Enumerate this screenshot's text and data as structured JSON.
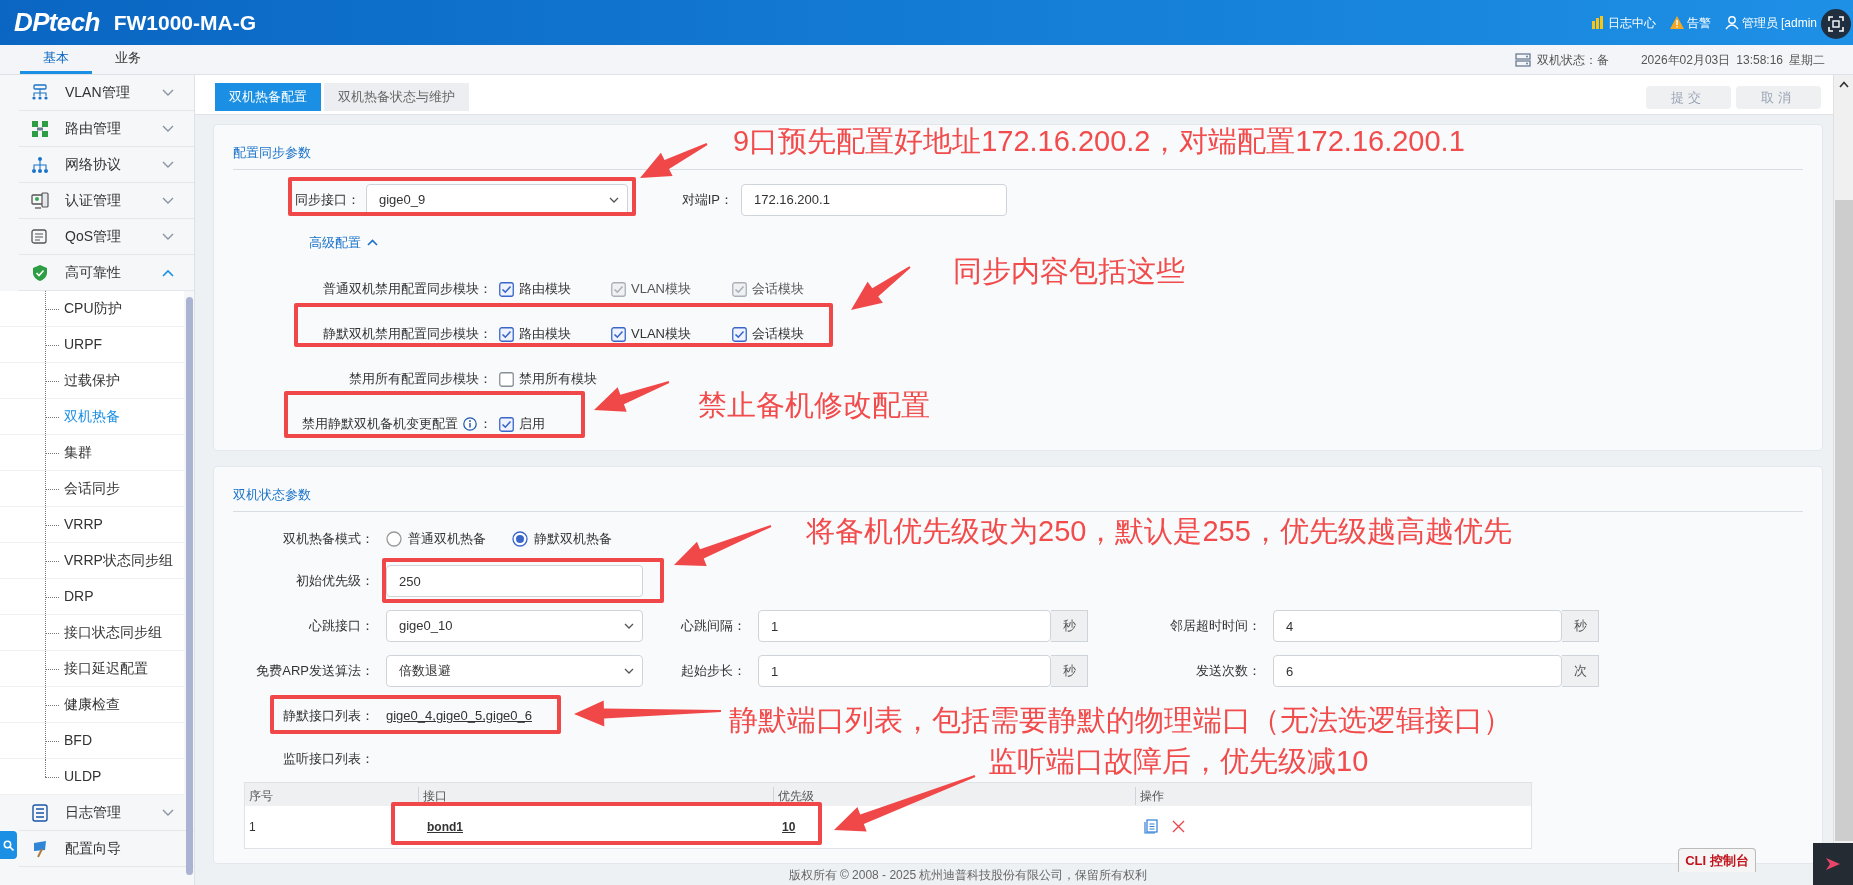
{
  "header": {
    "logo": "DPtech",
    "product": "FW1000-MA-G",
    "links": [
      {
        "label": "日志中心"
      },
      {
        "label": "告警"
      },
      {
        "label": "管理员 [admin"
      }
    ]
  },
  "nav_tabs": [
    {
      "label": "基本",
      "selected": true
    },
    {
      "label": "业务",
      "selected": false
    }
  ],
  "status_bar": {
    "ha_state": "双机状态：备",
    "date": "2026年02月03日",
    "time": "13:58:16",
    "weekday": "星期二"
  },
  "sidebar": {
    "items": [
      {
        "label": "VLAN管理",
        "kind": "group",
        "expanded": false
      },
      {
        "label": "路由管理",
        "kind": "group",
        "expanded": false
      },
      {
        "label": "网络协议",
        "kind": "group",
        "expanded": false
      },
      {
        "label": "认证管理",
        "kind": "group",
        "expanded": false
      },
      {
        "label": "QoS管理",
        "kind": "group",
        "expanded": false
      },
      {
        "label": "高可靠性",
        "kind": "group",
        "expanded": true,
        "children": [
          {
            "label": "CPU防护",
            "selected": false
          },
          {
            "label": "URPF",
            "selected": false
          },
          {
            "label": "过载保护",
            "selected": false
          },
          {
            "label": "双机热备",
            "selected": true
          },
          {
            "label": "集群",
            "selected": false
          },
          {
            "label": "会话同步",
            "selected": false
          },
          {
            "label": "VRRP",
            "selected": false
          },
          {
            "label": "VRRP状态同步组",
            "selected": false
          },
          {
            "label": "DRP",
            "selected": false
          },
          {
            "label": "接口状态同步组",
            "selected": false
          },
          {
            "label": "接口延迟配置",
            "selected": false
          },
          {
            "label": "健康检查",
            "selected": false
          },
          {
            "label": "BFD",
            "selected": false
          },
          {
            "label": "ULDP",
            "selected": false
          }
        ]
      },
      {
        "label": "日志管理",
        "kind": "group",
        "expanded": false
      },
      {
        "label": "配置向导",
        "kind": "link"
      }
    ]
  },
  "page_tabs": [
    {
      "label": "双机热备配置",
      "selected": true
    },
    {
      "label": "双机热备状态与维护",
      "selected": false
    }
  ],
  "actions": [
    {
      "label": "提交",
      "disabled": true
    },
    {
      "label": "取消",
      "disabled": true
    }
  ],
  "sync_section": {
    "title": "配置同步参数",
    "fields": [
      {
        "label": "同步接口：",
        "kind": "select",
        "value": "gige0_9"
      },
      {
        "label": "对端IP：",
        "kind": "input",
        "value": "172.16.200.1"
      }
    ],
    "advanced": {
      "label": "高级配置",
      "expanded": true
    },
    "module_rows": [
      {
        "label": "普通双机禁用配置同步模块",
        "colon": "：",
        "info": false,
        "options": [
          {
            "label": "路由模块",
            "checked": true,
            "disabled": false
          },
          {
            "label": "VLAN模块",
            "checked": true,
            "disabled": true
          },
          {
            "label": "会话模块",
            "checked": true,
            "disabled": true
          }
        ]
      },
      {
        "label": "静默双机禁用配置同步模块",
        "colon": "：",
        "info": false,
        "options": [
          {
            "label": "路由模块",
            "checked": true,
            "disabled": false
          },
          {
            "label": "VLAN模块",
            "checked": true,
            "disabled": false
          },
          {
            "label": "会话模块",
            "checked": true,
            "disabled": false
          }
        ]
      },
      {
        "label": "禁用所有配置同步模块",
        "colon": "：",
        "info": false,
        "options": [
          {
            "label": "禁用所有模块",
            "checked": false,
            "disabled": false
          }
        ]
      },
      {
        "label": "禁用静默双机备机变更配置",
        "colon": "：",
        "info": true,
        "options": [
          {
            "label": "启用",
            "checked": true,
            "disabled": false
          }
        ]
      }
    ]
  },
  "state_section": {
    "title": "双机状态参数",
    "mode": {
      "label": "双机热备模式：",
      "options": [
        {
          "label": "普通双机热备",
          "selected": false
        },
        {
          "label": "静默双机热备",
          "selected": true
        }
      ]
    },
    "initial_priority": {
      "label": "初始优先级：",
      "value": "250"
    },
    "field_rows": [
      [
        {
          "label": "心跳接口：",
          "kind": "select",
          "value": "gige0_10"
        },
        {
          "label": "心跳间隔：",
          "kind": "input",
          "value": "1",
          "unit": "秒"
        },
        {
          "label": "邻居超时时间：",
          "kind": "input",
          "value": "4",
          "unit": "秒"
        }
      ],
      [
        {
          "label": "免费ARP发送算法：",
          "kind": "select",
          "value": "倍数退避"
        },
        {
          "label": "起始步长：",
          "kind": "input",
          "value": "1",
          "unit": "秒"
        },
        {
          "label": "发送次数：",
          "kind": "input",
          "value": "6",
          "unit": "次"
        }
      ]
    ],
    "silent_interfaces": {
      "label": "静默接口列表：",
      "value": "gige0_4,gige0_5,gige0_6"
    },
    "monitor_interfaces": {
      "label": "监听接口列表：",
      "table": {
        "columns": [
          "序号",
          "接口",
          "优先级",
          "操作"
        ],
        "rows": [
          {
            "index": "1",
            "interface": "bond1",
            "priority": "10"
          }
        ]
      }
    }
  },
  "footer": "版权所有 © 2008 - 2025 杭州迪普科技股份有限公司，保留所有权利",
  "cli_button": "CLI 控制台",
  "annotations": [
    {
      "text": "9口预先配置好地址172.16.200.2，对端配置172.16.200.1"
    },
    {
      "text": "同步内容包括这些"
    },
    {
      "text": "禁止备机修改配置"
    },
    {
      "text": "将备机优先级改为250，默认是255，优先级越高越优先"
    },
    {
      "text": "静默端口列表，包括需要静默的物理端口（无法选逻辑接口）"
    },
    {
      "text": "监听端口故障后，优先级减10"
    }
  ]
}
